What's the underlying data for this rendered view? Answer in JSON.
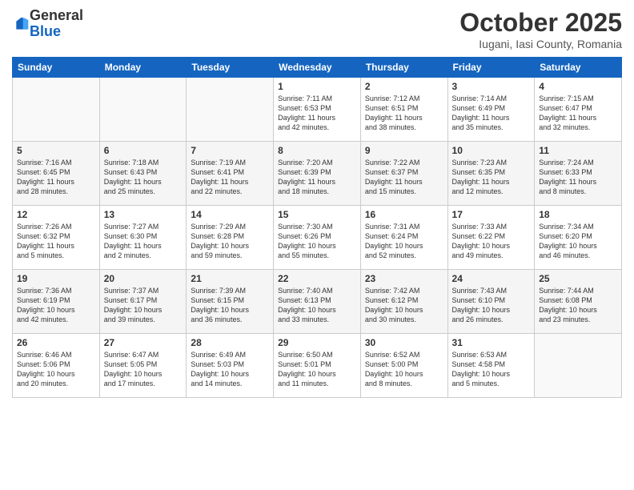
{
  "header": {
    "logo": {
      "general": "General",
      "blue": "Blue"
    },
    "title": "October 2025",
    "subtitle": "Iugani, Iasi County, Romania"
  },
  "weekdays": [
    "Sunday",
    "Monday",
    "Tuesday",
    "Wednesday",
    "Thursday",
    "Friday",
    "Saturday"
  ],
  "weeks": [
    [
      {
        "day": "",
        "content": ""
      },
      {
        "day": "",
        "content": ""
      },
      {
        "day": "",
        "content": ""
      },
      {
        "day": "1",
        "content": "Sunrise: 7:11 AM\nSunset: 6:53 PM\nDaylight: 11 hours\nand 42 minutes."
      },
      {
        "day": "2",
        "content": "Sunrise: 7:12 AM\nSunset: 6:51 PM\nDaylight: 11 hours\nand 38 minutes."
      },
      {
        "day": "3",
        "content": "Sunrise: 7:14 AM\nSunset: 6:49 PM\nDaylight: 11 hours\nand 35 minutes."
      },
      {
        "day": "4",
        "content": "Sunrise: 7:15 AM\nSunset: 6:47 PM\nDaylight: 11 hours\nand 32 minutes."
      }
    ],
    [
      {
        "day": "5",
        "content": "Sunrise: 7:16 AM\nSunset: 6:45 PM\nDaylight: 11 hours\nand 28 minutes."
      },
      {
        "day": "6",
        "content": "Sunrise: 7:18 AM\nSunset: 6:43 PM\nDaylight: 11 hours\nand 25 minutes."
      },
      {
        "day": "7",
        "content": "Sunrise: 7:19 AM\nSunset: 6:41 PM\nDaylight: 11 hours\nand 22 minutes."
      },
      {
        "day": "8",
        "content": "Sunrise: 7:20 AM\nSunset: 6:39 PM\nDaylight: 11 hours\nand 18 minutes."
      },
      {
        "day": "9",
        "content": "Sunrise: 7:22 AM\nSunset: 6:37 PM\nDaylight: 11 hours\nand 15 minutes."
      },
      {
        "day": "10",
        "content": "Sunrise: 7:23 AM\nSunset: 6:35 PM\nDaylight: 11 hours\nand 12 minutes."
      },
      {
        "day": "11",
        "content": "Sunrise: 7:24 AM\nSunset: 6:33 PM\nDaylight: 11 hours\nand 8 minutes."
      }
    ],
    [
      {
        "day": "12",
        "content": "Sunrise: 7:26 AM\nSunset: 6:32 PM\nDaylight: 11 hours\nand 5 minutes."
      },
      {
        "day": "13",
        "content": "Sunrise: 7:27 AM\nSunset: 6:30 PM\nDaylight: 11 hours\nand 2 minutes."
      },
      {
        "day": "14",
        "content": "Sunrise: 7:29 AM\nSunset: 6:28 PM\nDaylight: 10 hours\nand 59 minutes."
      },
      {
        "day": "15",
        "content": "Sunrise: 7:30 AM\nSunset: 6:26 PM\nDaylight: 10 hours\nand 55 minutes."
      },
      {
        "day": "16",
        "content": "Sunrise: 7:31 AM\nSunset: 6:24 PM\nDaylight: 10 hours\nand 52 minutes."
      },
      {
        "day": "17",
        "content": "Sunrise: 7:33 AM\nSunset: 6:22 PM\nDaylight: 10 hours\nand 49 minutes."
      },
      {
        "day": "18",
        "content": "Sunrise: 7:34 AM\nSunset: 6:20 PM\nDaylight: 10 hours\nand 46 minutes."
      }
    ],
    [
      {
        "day": "19",
        "content": "Sunrise: 7:36 AM\nSunset: 6:19 PM\nDaylight: 10 hours\nand 42 minutes."
      },
      {
        "day": "20",
        "content": "Sunrise: 7:37 AM\nSunset: 6:17 PM\nDaylight: 10 hours\nand 39 minutes."
      },
      {
        "day": "21",
        "content": "Sunrise: 7:39 AM\nSunset: 6:15 PM\nDaylight: 10 hours\nand 36 minutes."
      },
      {
        "day": "22",
        "content": "Sunrise: 7:40 AM\nSunset: 6:13 PM\nDaylight: 10 hours\nand 33 minutes."
      },
      {
        "day": "23",
        "content": "Sunrise: 7:42 AM\nSunset: 6:12 PM\nDaylight: 10 hours\nand 30 minutes."
      },
      {
        "day": "24",
        "content": "Sunrise: 7:43 AM\nSunset: 6:10 PM\nDaylight: 10 hours\nand 26 minutes."
      },
      {
        "day": "25",
        "content": "Sunrise: 7:44 AM\nSunset: 6:08 PM\nDaylight: 10 hours\nand 23 minutes."
      }
    ],
    [
      {
        "day": "26",
        "content": "Sunrise: 6:46 AM\nSunset: 5:06 PM\nDaylight: 10 hours\nand 20 minutes."
      },
      {
        "day": "27",
        "content": "Sunrise: 6:47 AM\nSunset: 5:05 PM\nDaylight: 10 hours\nand 17 minutes."
      },
      {
        "day": "28",
        "content": "Sunrise: 6:49 AM\nSunset: 5:03 PM\nDaylight: 10 hours\nand 14 minutes."
      },
      {
        "day": "29",
        "content": "Sunrise: 6:50 AM\nSunset: 5:01 PM\nDaylight: 10 hours\nand 11 minutes."
      },
      {
        "day": "30",
        "content": "Sunrise: 6:52 AM\nSunset: 5:00 PM\nDaylight: 10 hours\nand 8 minutes."
      },
      {
        "day": "31",
        "content": "Sunrise: 6:53 AM\nSunset: 4:58 PM\nDaylight: 10 hours\nand 5 minutes."
      },
      {
        "day": "",
        "content": ""
      }
    ]
  ]
}
